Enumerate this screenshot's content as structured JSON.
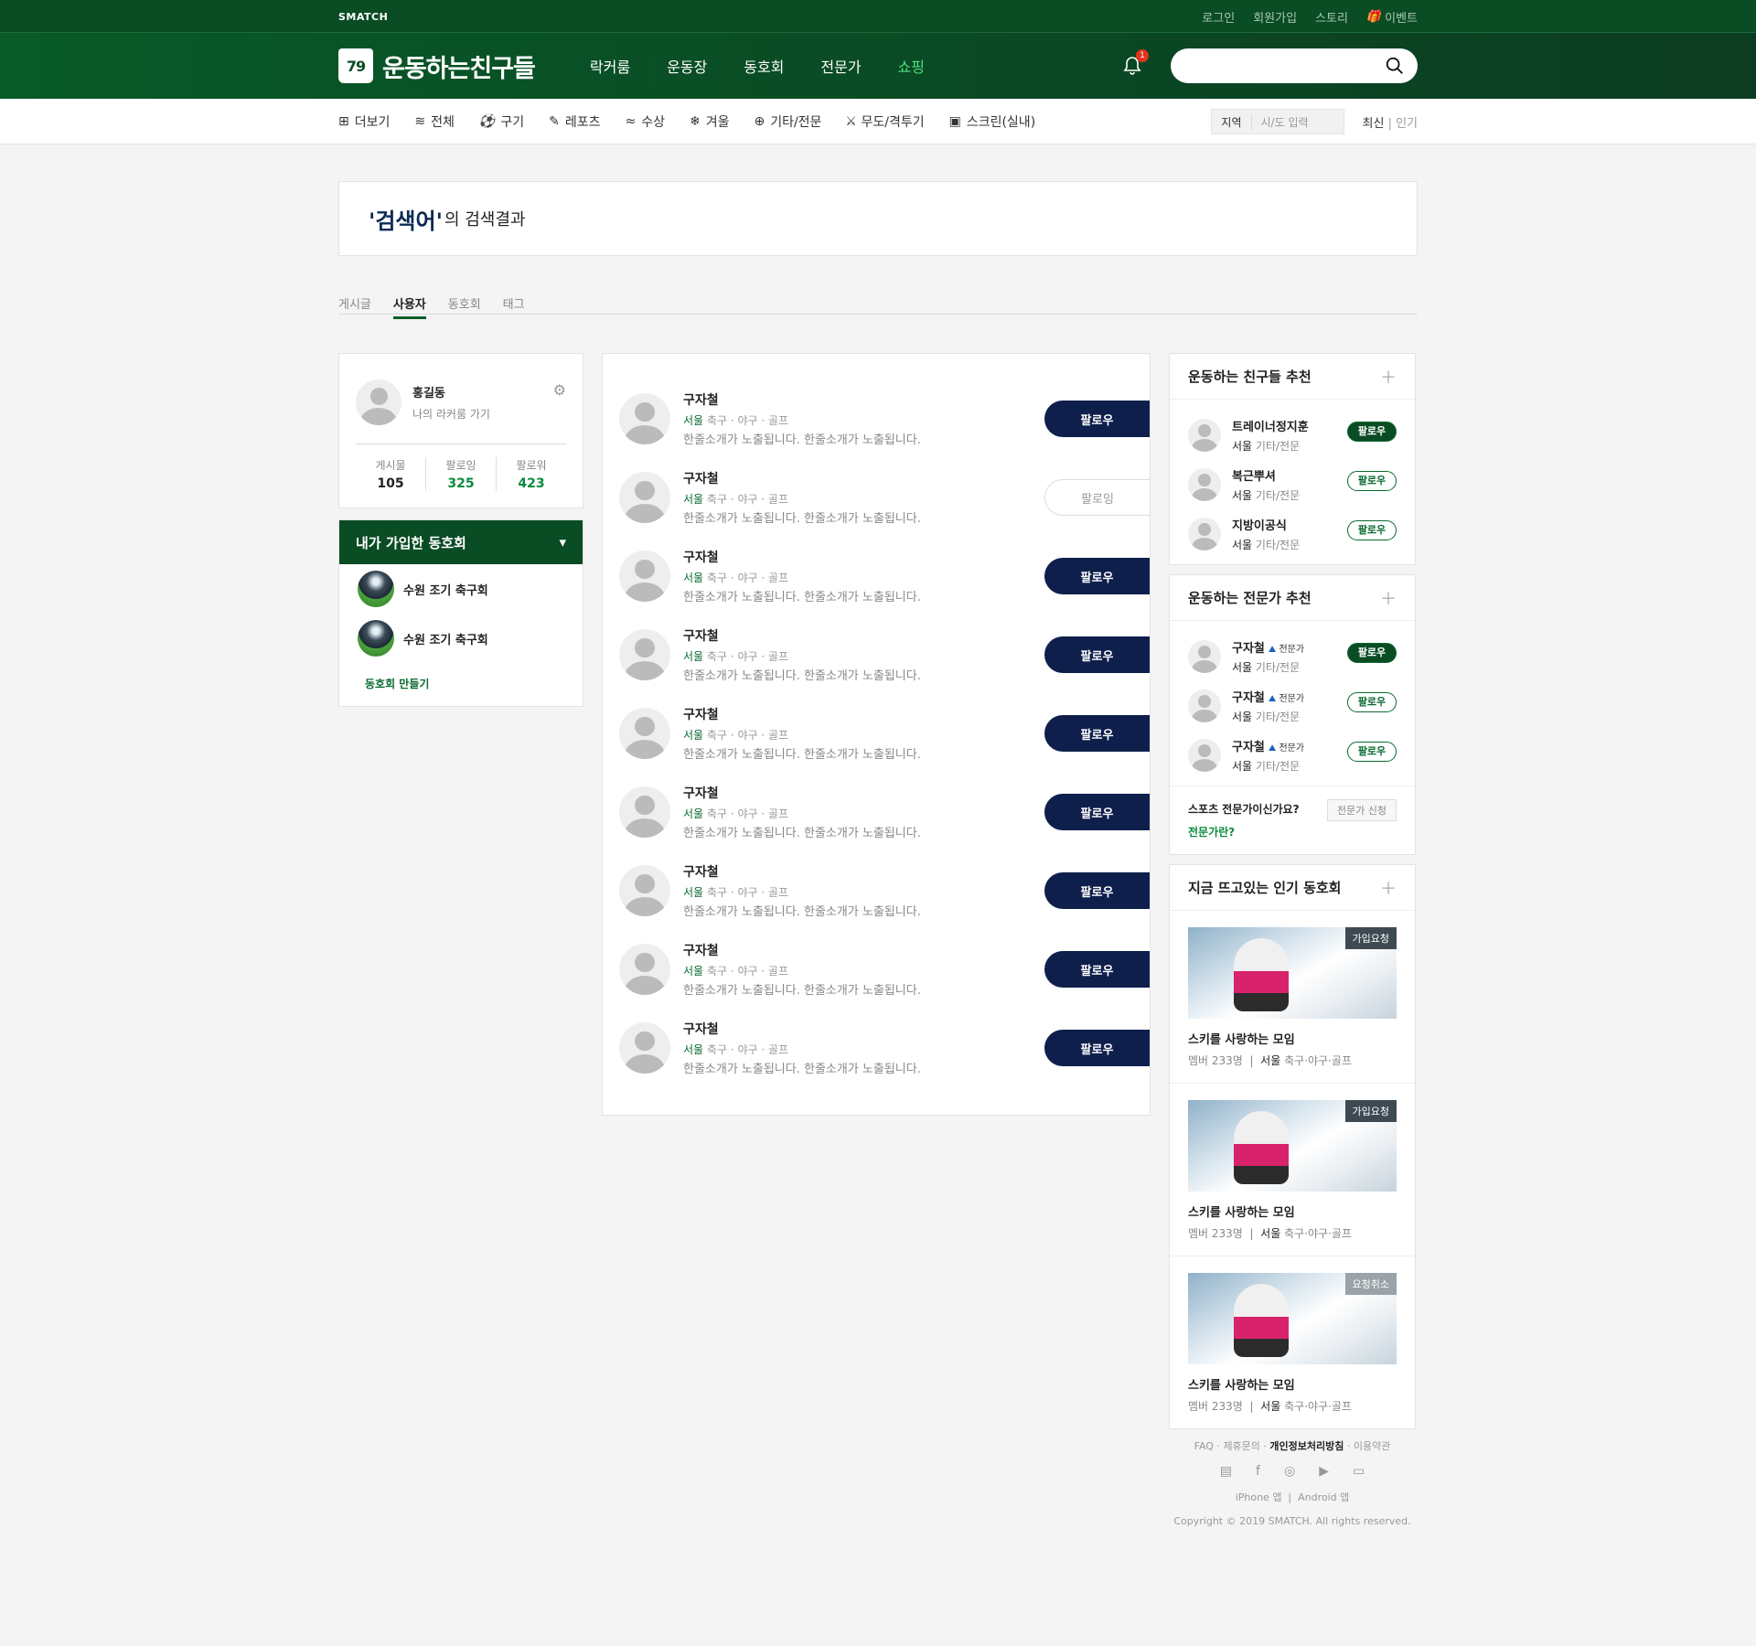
{
  "topbar": {
    "brand": "SMATCH",
    "util": [
      "로그인",
      "회원가입",
      "스토리",
      "이벤트"
    ]
  },
  "header": {
    "logo_num": "79",
    "logo_text": "운동하는친구들",
    "nav": [
      "락커룸",
      "운동장",
      "동호회",
      "전문가",
      "쇼핑"
    ],
    "bell_count": "1",
    "search_placeholder": ""
  },
  "cats": {
    "items": [
      "더보기",
      "전체",
      "구기",
      "레포츠",
      "수상",
      "겨울",
      "기타/전문",
      "무도/격투기",
      "스크린(실내)"
    ],
    "region_label": "지역",
    "region_placeholder": "시/도 입력",
    "sort": [
      "최신",
      "인기"
    ]
  },
  "result": {
    "keyword": "'검색어'",
    "suffix": "의 검색결과"
  },
  "tabs": [
    "게시글",
    "사용자",
    "동호회",
    "태그"
  ],
  "profile": {
    "name": "홍길동",
    "link": "나의 라커룸 가기",
    "stats": [
      {
        "label": "게시물",
        "value": "105"
      },
      {
        "label": "팔로잉",
        "value": "325"
      },
      {
        "label": "팔로워",
        "value": "423"
      }
    ]
  },
  "clubs": {
    "title": "내가 가입한 동호회",
    "items": [
      "수원 조기 축구회",
      "수원 조기 축구회"
    ],
    "make": "동호회 만들기"
  },
  "users": [
    {
      "name": "구자철",
      "city": "서울",
      "sports": "축구 · 야구 · 골프",
      "desc": "한줄소개가 노출됩니다. 한줄소개가 노출됩니다.",
      "button": "팔로우",
      "following": false
    },
    {
      "name": "구자철",
      "city": "서울",
      "sports": "축구 · 야구 · 골프",
      "desc": "한줄소개가 노출됩니다. 한줄소개가 노출됩니다.",
      "button": "팔로잉",
      "following": true
    },
    {
      "name": "구자철",
      "city": "서울",
      "sports": "축구 · 야구 · 골프",
      "desc": "한줄소개가 노출됩니다. 한줄소개가 노출됩니다.",
      "button": "팔로우",
      "following": false
    },
    {
      "name": "구자철",
      "city": "서울",
      "sports": "축구 · 야구 · 골프",
      "desc": "한줄소개가 노출됩니다. 한줄소개가 노출됩니다.",
      "button": "팔로우",
      "following": false
    },
    {
      "name": "구자철",
      "city": "서울",
      "sports": "축구 · 야구 · 골프",
      "desc": "한줄소개가 노출됩니다. 한줄소개가 노출됩니다.",
      "button": "팔로우",
      "following": false
    },
    {
      "name": "구자철",
      "city": "서울",
      "sports": "축구 · 야구 · 골프",
      "desc": "한줄소개가 노출됩니다. 한줄소개가 노출됩니다.",
      "button": "팔로우",
      "following": false
    },
    {
      "name": "구자철",
      "city": "서울",
      "sports": "축구 · 야구 · 골프",
      "desc": "한줄소개가 노출됩니다. 한줄소개가 노출됩니다.",
      "button": "팔로우",
      "following": false
    },
    {
      "name": "구자철",
      "city": "서울",
      "sports": "축구 · 야구 · 골프",
      "desc": "한줄소개가 노출됩니다. 한줄소개가 노출됩니다.",
      "button": "팔로우",
      "following": false
    },
    {
      "name": "구자철",
      "city": "서울",
      "sports": "축구 · 야구 · 골프",
      "desc": "한줄소개가 노출됩니다. 한줄소개가 노출됩니다.",
      "button": "팔로우",
      "following": false
    }
  ],
  "friends": {
    "title": "운동하는 친구들 추천",
    "items": [
      {
        "name": "트레이너정지훈",
        "city": "서울",
        "cat": "기타/전문",
        "button": "팔로우",
        "fill": true
      },
      {
        "name": "복근뿌셔",
        "city": "서울",
        "cat": "기타/전문",
        "button": "팔로우",
        "fill": false
      },
      {
        "name": "지방이공식",
        "city": "서울",
        "cat": "기타/전문",
        "button": "팔로우",
        "fill": false
      }
    ]
  },
  "experts": {
    "title": "운동하는 전문가 추천",
    "badge": "전문가",
    "items": [
      {
        "name": "구자철",
        "city": "서울",
        "cat": "기타/전문",
        "button": "팔로우",
        "fill": true
      },
      {
        "name": "구자철",
        "city": "서울",
        "cat": "기타/전문",
        "button": "팔로우",
        "fill": false
      },
      {
        "name": "구자철",
        "city": "서울",
        "cat": "기타/전문",
        "button": "팔로우",
        "fill": false
      }
    ],
    "question": "스포츠 전문가이신가요?",
    "what": "전문가란?",
    "apply": "전문가 신청"
  },
  "groups": {
    "title": "지금 뜨고있는 인기 동호회",
    "items": [
      {
        "tag": "가입요청",
        "tag_off": false,
        "title": "스키를 사랑하는 모임",
        "members": "멤버 233명",
        "city": "서울",
        "sports": "축구·야구·골프"
      },
      {
        "tag": "가입요청",
        "tag_off": false,
        "title": "스키를 사랑하는 모임",
        "members": "멤버 233명",
        "city": "서울",
        "sports": "축구·야구·골프"
      },
      {
        "tag": "요청취소",
        "tag_off": true,
        "title": "스키를 사랑하는 모임",
        "members": "멤버 233명",
        "city": "서울",
        "sports": "축구·야구·골프"
      }
    ]
  },
  "footer": {
    "links": [
      "FAQ",
      "제휴문의",
      "개인정보처리방침",
      "이용약관"
    ],
    "apps": [
      "iPhone 앱",
      "Android 앱"
    ],
    "copyright": "Copyright © 2019 SMATCH. All rights reserved."
  }
}
